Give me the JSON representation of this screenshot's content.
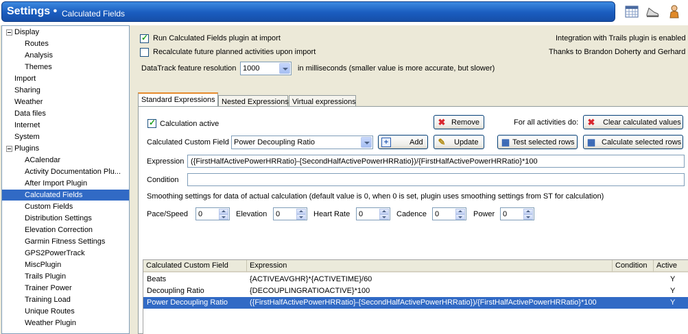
{
  "title": {
    "main": "Settings •",
    "sub": "Calculated Fields",
    "icons": [
      "calendar-icon",
      "shoe-icon",
      "athlete-icon"
    ]
  },
  "sidebar": {
    "items": [
      {
        "label": "Display",
        "level": 0,
        "expanded": true
      },
      {
        "label": "Routes",
        "level": 1
      },
      {
        "label": "Analysis",
        "level": 1
      },
      {
        "label": "Themes",
        "level": 1
      },
      {
        "label": "Import",
        "level": 0
      },
      {
        "label": "Sharing",
        "level": 0
      },
      {
        "label": "Weather",
        "level": 0
      },
      {
        "label": "Data files",
        "level": 0
      },
      {
        "label": "Internet",
        "level": 0
      },
      {
        "label": "System",
        "level": 0
      },
      {
        "label": "Plugins",
        "level": 0,
        "expanded": true
      },
      {
        "label": "ACalendar",
        "level": 1
      },
      {
        "label": "Activity  Documentation  Plu...",
        "level": 1
      },
      {
        "label": "After Import Plugin",
        "level": 1
      },
      {
        "label": "Calculated Fields",
        "level": 1,
        "selected": true
      },
      {
        "label": "Custom Fields",
        "level": 1
      },
      {
        "label": "Distribution Settings",
        "level": 1
      },
      {
        "label": "Elevation Correction",
        "level": 1
      },
      {
        "label": "Garmin Fitness Settings",
        "level": 1
      },
      {
        "label": "GPS2PowerTrack",
        "level": 1
      },
      {
        "label": "MiscPlugin",
        "level": 1
      },
      {
        "label": "Trails Plugin",
        "level": 1
      },
      {
        "label": "Trainer Power",
        "level": 1
      },
      {
        "label": "Training Load",
        "level": 1
      },
      {
        "label": "Unique Routes",
        "level": 1
      },
      {
        "label": "Weather Plugin",
        "level": 1
      }
    ]
  },
  "top": {
    "run_at_import": {
      "label": "Run Calculated Fields plugin at import",
      "checked": true
    },
    "recalc_future": {
      "label": "Recalculate future planned activities upon import",
      "checked": false
    },
    "datatrack_label": "DataTrack feature resolution",
    "datatrack_value": "1000",
    "datatrack_hint": "in milliseconds (smaller value is more accurate, but slower)",
    "trails_info": "Integration with Trails plugin is enabled",
    "thanks": "Thanks to Brandon Doherty and Gerhard"
  },
  "tabs": [
    {
      "label": "Standard Expressions",
      "active": true
    },
    {
      "label": "Nested Expressions"
    },
    {
      "label": "Virtual expressions"
    }
  ],
  "standard": {
    "calc_active": {
      "label": "Calculation active",
      "checked": true
    },
    "remove_label": "Remove",
    "all_activities_label": "For all activities do:",
    "clear_label": "Clear calculated values",
    "custom_field_label": "Calculated Custom Field",
    "custom_field_value": "Power Decoupling Ratio",
    "add_label": "Add",
    "update_label": "Update",
    "test_label": "Test selected rows",
    "calc_selected_label": "Calculate selected rows",
    "expression_label": "Expression",
    "expression_value": "({FirstHalfActivePowerHRRatio}-{SecondHalfActivePowerHRRatio})/{FirstHalfActivePowerHRRatio}*100",
    "condition_label": "Condition",
    "condition_value": "",
    "smoothing_note": "Smoothing settings for data of actual calculation (default value is 0, when 0 is set, plugin uses smoothing settings from ST for calculation)",
    "smoothing": [
      {
        "label": "Pace/Speed",
        "value": "0"
      },
      {
        "label": "Elevation",
        "value": "0"
      },
      {
        "label": "Heart Rate",
        "value": "0"
      },
      {
        "label": "Cadence",
        "value": "0"
      },
      {
        "label": "Power",
        "value": "0"
      }
    ]
  },
  "grid": {
    "columns": [
      "Calculated Custom Field",
      "Expression",
      "Condition",
      "Active"
    ],
    "rows": [
      {
        "field": "Beats",
        "expression": "{ACTIVEAVGHR}*{ACTIVETIME}/60",
        "condition": "",
        "active": "Y"
      },
      {
        "field": "Decoupling Ratio",
        "expression": "{DECOUPLINGRATIOACTIVE}*100",
        "condition": "",
        "active": "Y"
      },
      {
        "field": "Power Decoupling Ratio",
        "expression": "({FirstHalfActivePowerHRRatio}-{SecondHalfActivePowerHRRatio})/{FirstHalfActivePowerHRRatio}*100",
        "condition": "",
        "active": "Y",
        "selected": true
      }
    ]
  },
  "colors": {
    "title_blue": "#1a5cbf",
    "selection": "#316ac5",
    "tab_highlight": "#e68b2c",
    "remove_red": "#d8262e"
  }
}
